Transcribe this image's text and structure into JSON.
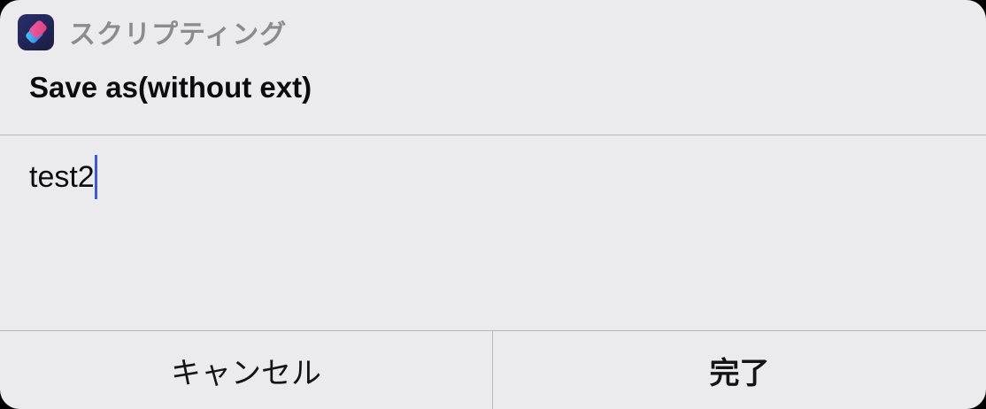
{
  "app": {
    "name": "スクリプティング",
    "icon": "shortcuts-app-icon"
  },
  "prompt": {
    "title": "Save as(without ext)"
  },
  "input": {
    "value": "test2",
    "caret_color": "#3c5ad2"
  },
  "buttons": {
    "cancel_label": "キャンセル",
    "done_label": "完了"
  }
}
